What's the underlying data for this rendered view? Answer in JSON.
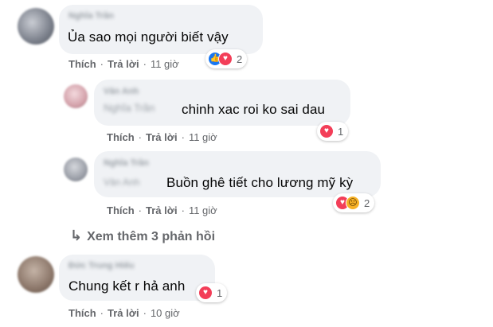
{
  "comments": [
    {
      "author_blurred": "Nghĩa Trần",
      "text": "Ủa sao mọi người biết vậy",
      "like_label": "Thích",
      "reply_label": "Trả lời",
      "time": "11 giờ",
      "reactions": [
        "like-icon",
        "love-icon"
      ],
      "reaction_count": "2"
    },
    {
      "author_blurred": "Vân Anh",
      "mention_blurred": "Nghĩa Trần",
      "text": "chinh xac roi ko sai dau",
      "like_label": "Thích",
      "reply_label": "Trả lời",
      "time": "11 giờ",
      "reactions": [
        "love-icon"
      ],
      "reaction_count": "1"
    },
    {
      "author_blurred": "Nghĩa Trần",
      "mention_blurred": "Vân Anh",
      "text": "Buồn ghê tiết cho lương mỹ kỳ",
      "like_label": "Thích",
      "reply_label": "Trả lời",
      "time": "11 giờ",
      "reactions": [
        "love-icon",
        "sad-icon"
      ],
      "reaction_count": "2"
    },
    {
      "author_blurred": "Đức Trung Hiếu",
      "text": "Chung kết r hả anh",
      "like_label": "Thích",
      "reply_label": "Trả lời",
      "time": "10 giờ",
      "reactions": [
        "love-icon"
      ],
      "reaction_count": "1"
    }
  ],
  "more_replies": {
    "arrow_icon": "reply-arrow-icon",
    "label": "Xem thêm 3 phản hồi"
  },
  "colors": {
    "bubble": "#f0f2f5",
    "secondary_text": "#65676b",
    "like": "#1877f2",
    "love": "#f33e58",
    "sad": "#f7b125"
  }
}
